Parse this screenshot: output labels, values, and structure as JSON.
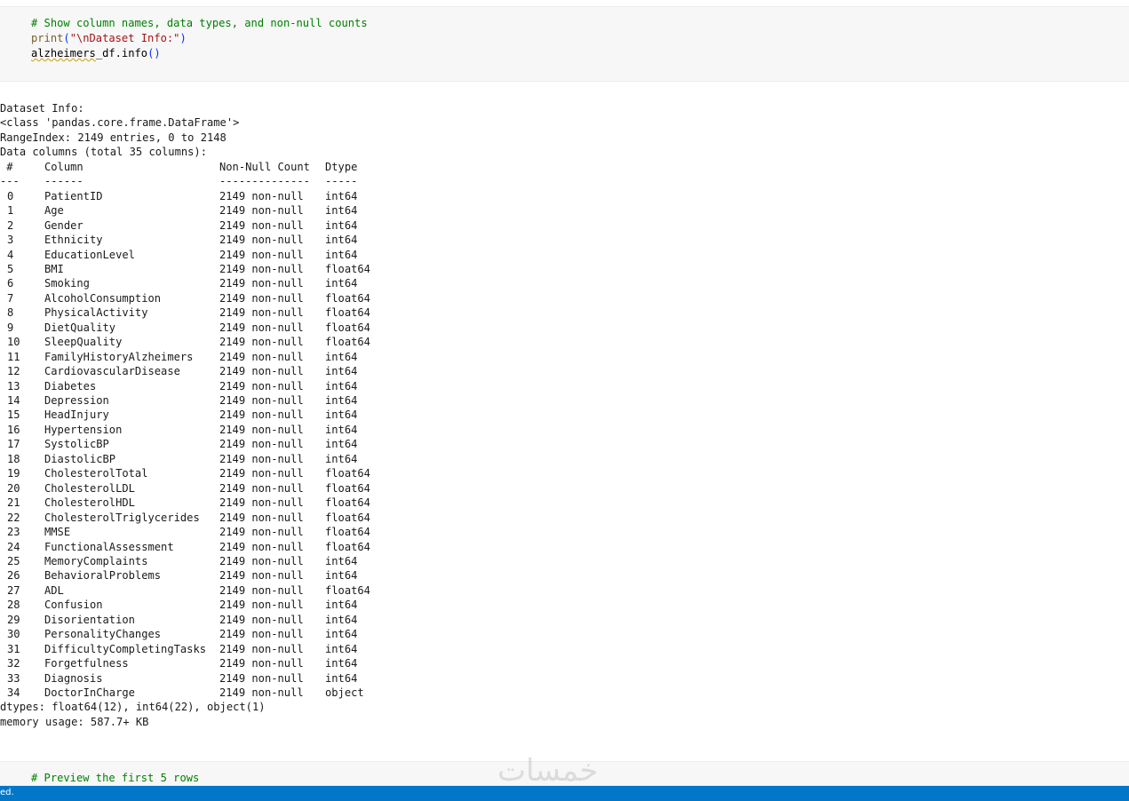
{
  "cell1": {
    "comment": "# Show column names, data types, and non-null counts",
    "print_fn": "print",
    "print_open": "(",
    "print_arg": "\"\\nDataset Info:\"",
    "print_close": ")",
    "df_name": "alzheimers",
    "df_rest": "_df.info",
    "call_parens": "()"
  },
  "output": {
    "title": "Dataset Info:",
    "class_line": "<class 'pandas.core.frame.DataFrame'>",
    "range_index": "RangeIndex: 2149 entries, 0 to 2148",
    "data_columns": "Data columns (total 35 columns):",
    "header": {
      "idx": " #",
      "name": "Column",
      "count": "Non-Null Count",
      "dtype": "Dtype"
    },
    "separator": {
      "idx": "---",
      "name": "------",
      "count": "--------------",
      "dtype": "-----"
    },
    "rows": [
      {
        "idx": "0",
        "name": "PatientID",
        "count": "2149 non-null",
        "dtype": "int64"
      },
      {
        "idx": "1",
        "name": "Age",
        "count": "2149 non-null",
        "dtype": "int64"
      },
      {
        "idx": "2",
        "name": "Gender",
        "count": "2149 non-null",
        "dtype": "int64"
      },
      {
        "idx": "3",
        "name": "Ethnicity",
        "count": "2149 non-null",
        "dtype": "int64"
      },
      {
        "idx": "4",
        "name": "EducationLevel",
        "count": "2149 non-null",
        "dtype": "int64"
      },
      {
        "idx": "5",
        "name": "BMI",
        "count": "2149 non-null",
        "dtype": "float64"
      },
      {
        "idx": "6",
        "name": "Smoking",
        "count": "2149 non-null",
        "dtype": "int64"
      },
      {
        "idx": "7",
        "name": "AlcoholConsumption",
        "count": "2149 non-null",
        "dtype": "float64"
      },
      {
        "idx": "8",
        "name": "PhysicalActivity",
        "count": "2149 non-null",
        "dtype": "float64"
      },
      {
        "idx": "9",
        "name": "DietQuality",
        "count": "2149 non-null",
        "dtype": "float64"
      },
      {
        "idx": "10",
        "name": "SleepQuality",
        "count": "2149 non-null",
        "dtype": "float64"
      },
      {
        "idx": "11",
        "name": "FamilyHistoryAlzheimers",
        "count": "2149 non-null",
        "dtype": "int64"
      },
      {
        "idx": "12",
        "name": "CardiovascularDisease",
        "count": "2149 non-null",
        "dtype": "int64"
      },
      {
        "idx": "13",
        "name": "Diabetes",
        "count": "2149 non-null",
        "dtype": "int64"
      },
      {
        "idx": "14",
        "name": "Depression",
        "count": "2149 non-null",
        "dtype": "int64"
      },
      {
        "idx": "15",
        "name": "HeadInjury",
        "count": "2149 non-null",
        "dtype": "int64"
      },
      {
        "idx": "16",
        "name": "Hypertension",
        "count": "2149 non-null",
        "dtype": "int64"
      },
      {
        "idx": "17",
        "name": "SystolicBP",
        "count": "2149 non-null",
        "dtype": "int64"
      },
      {
        "idx": "18",
        "name": "DiastolicBP",
        "count": "2149 non-null",
        "dtype": "int64"
      },
      {
        "idx": "19",
        "name": "CholesterolTotal",
        "count": "2149 non-null",
        "dtype": "float64"
      },
      {
        "idx": "20",
        "name": "CholesterolLDL",
        "count": "2149 non-null",
        "dtype": "float64"
      },
      {
        "idx": "21",
        "name": "CholesterolHDL",
        "count": "2149 non-null",
        "dtype": "float64"
      },
      {
        "idx": "22",
        "name": "CholesterolTriglycerides",
        "count": "2149 non-null",
        "dtype": "float64"
      },
      {
        "idx": "23",
        "name": "MMSE",
        "count": "2149 non-null",
        "dtype": "float64"
      },
      {
        "idx": "24",
        "name": "FunctionalAssessment",
        "count": "2149 non-null",
        "dtype": "float64"
      },
      {
        "idx": "25",
        "name": "MemoryComplaints",
        "count": "2149 non-null",
        "dtype": "int64"
      },
      {
        "idx": "26",
        "name": "BehavioralProblems",
        "count": "2149 non-null",
        "dtype": "int64"
      },
      {
        "idx": "27",
        "name": "ADL",
        "count": "2149 non-null",
        "dtype": "float64"
      },
      {
        "idx": "28",
        "name": "Confusion",
        "count": "2149 non-null",
        "dtype": "int64"
      },
      {
        "idx": "29",
        "name": "Disorientation",
        "count": "2149 non-null",
        "dtype": "int64"
      },
      {
        "idx": "30",
        "name": "PersonalityChanges",
        "count": "2149 non-null",
        "dtype": "int64"
      },
      {
        "idx": "31",
        "name": "DifficultyCompletingTasks",
        "count": "2149 non-null",
        "dtype": "int64"
      },
      {
        "idx": "32",
        "name": "Forgetfulness",
        "count": "2149 non-null",
        "dtype": "int64"
      },
      {
        "idx": "33",
        "name": "Diagnosis",
        "count": "2149 non-null",
        "dtype": "int64"
      },
      {
        "idx": "34",
        "name": "DoctorInCharge",
        "count": "2149 non-null",
        "dtype": "object"
      }
    ],
    "dtypes_summary": "dtypes: float64(12), int64(22), object(1)",
    "memory_usage": "memory usage: 587.7+ KB"
  },
  "cell2": {
    "comment": "# Preview the first 5 rows"
  },
  "statusbar": {
    "text": "ed."
  },
  "watermark": {
    "text": "خمسات"
  },
  "colors": {
    "comment": "#008000",
    "builtin": "#795e26",
    "string": "#a31515",
    "paren": "#0431fa",
    "statusbar": "#0277c9",
    "cell_bg": "#f7f7f7"
  }
}
